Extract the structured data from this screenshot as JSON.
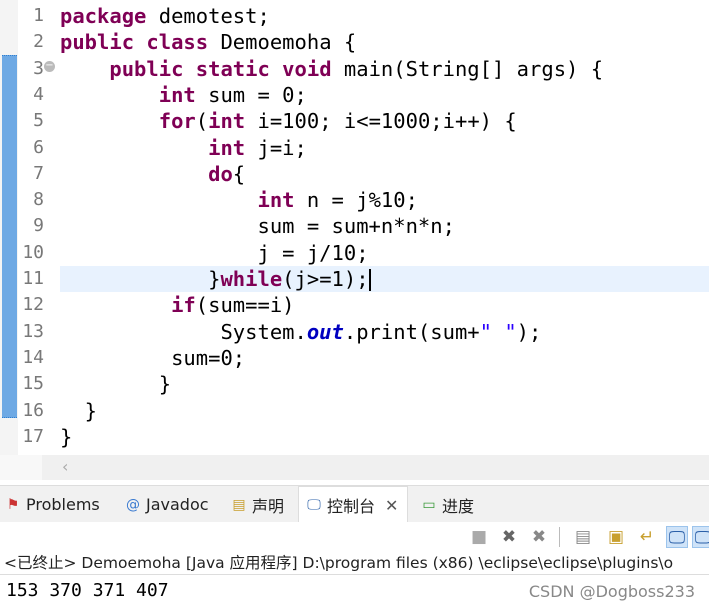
{
  "editor": {
    "line_numbers": [
      "1",
      "2",
      "3",
      "4",
      "5",
      "6",
      "7",
      "8",
      "9",
      "10",
      "11",
      "12",
      "13",
      "14",
      "15",
      "16",
      "17"
    ],
    "current_line": 11,
    "lines": [
      [
        [
          "package",
          "k"
        ],
        [
          " demotest;",
          ""
        ]
      ],
      [
        [
          "public class",
          "k"
        ],
        [
          " Demoemoha {",
          ""
        ]
      ],
      [
        [
          "    ",
          ""
        ],
        [
          "public static void",
          "k"
        ],
        [
          " main(String[] args) {",
          ""
        ]
      ],
      [
        [
          "        ",
          ""
        ],
        [
          "int",
          "k"
        ],
        [
          " sum = 0;",
          ""
        ]
      ],
      [
        [
          "        ",
          ""
        ],
        [
          "for",
          "k"
        ],
        [
          "(",
          ""
        ],
        [
          "int",
          "k"
        ],
        [
          " i=100; i<=1000;i++) {",
          ""
        ]
      ],
      [
        [
          "            ",
          ""
        ],
        [
          "int",
          "k"
        ],
        [
          " j=i;",
          ""
        ]
      ],
      [
        [
          "            ",
          ""
        ],
        [
          "do",
          "k"
        ],
        [
          "{",
          ""
        ]
      ],
      [
        [
          "                ",
          ""
        ],
        [
          "int",
          "k"
        ],
        [
          " n = j%10;",
          ""
        ]
      ],
      [
        [
          "                sum = sum+n*n*n;",
          ""
        ]
      ],
      [
        [
          "                j = j/10;",
          ""
        ]
      ],
      [
        [
          "            }",
          ""
        ],
        [
          "while",
          "k"
        ],
        [
          "(j>=1);",
          ""
        ]
      ],
      [
        [
          "         ",
          ""
        ],
        [
          "if",
          "k"
        ],
        [
          "(sum==i)",
          ""
        ]
      ],
      [
        [
          "             System.",
          ""
        ],
        [
          "out",
          "f"
        ],
        [
          ".print(sum+",
          ""
        ],
        [
          "\" \"",
          "s"
        ],
        [
          ");",
          ""
        ]
      ],
      [
        [
          "         sum=0;",
          ""
        ]
      ],
      [
        [
          "        }",
          ""
        ]
      ],
      [
        [
          "  }",
          ""
        ]
      ],
      [
        [
          "}",
          ""
        ]
      ]
    ]
  },
  "panel": {
    "tabs": [
      {
        "label": "Problems",
        "icon": "problems-icon"
      },
      {
        "label": "Javadoc",
        "icon": "at-icon"
      },
      {
        "label": "声明",
        "icon": "declaration-icon"
      },
      {
        "label": "控制台",
        "icon": "console-icon",
        "active": true
      },
      {
        "label": "进度",
        "icon": "progress-icon"
      }
    ],
    "close_symbol": "✕",
    "status": "<已终止> Demoemoha [Java 应用程序] D:\\program files  (x86)  \\eclipse\\eclipse\\plugins\\o",
    "output": "153 370 371 407"
  },
  "watermark": "CSDN @Dogboss233",
  "colors": {
    "keyword": "#7f0055",
    "field": "#0000c0",
    "string": "#2a00ff",
    "current_line": "#e8f2fe"
  }
}
